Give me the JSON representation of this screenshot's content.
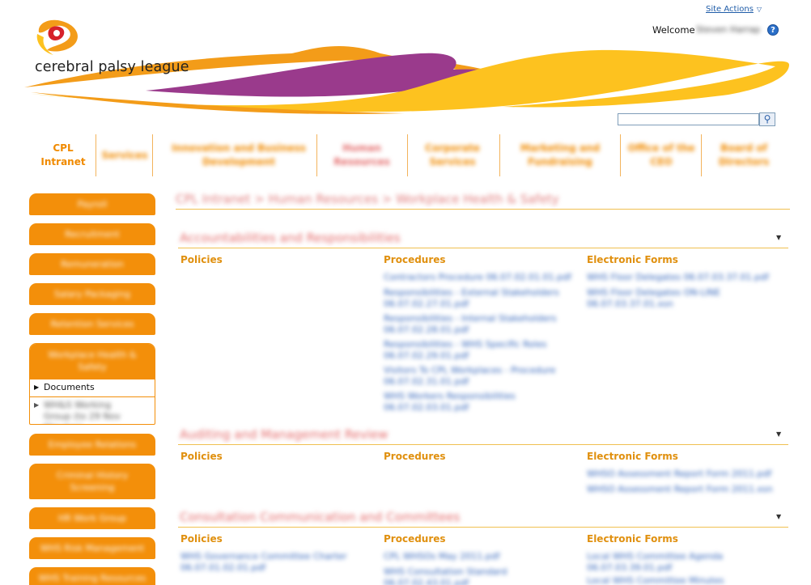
{
  "header": {
    "site_actions": "Site Actions",
    "welcome": "Welcome",
    "user_name": "Steven Harrap",
    "help": "?",
    "logo_text": "cerebral palsy league",
    "search": {
      "placeholder": "",
      "value": ""
    }
  },
  "top_nav": [
    "CPL Intranet",
    "Services",
    "Innovation and Business Development",
    "Human Resources",
    "Corporate Services",
    "Marketing and Fundraising",
    "Office of the CEO",
    "Board of Directors"
  ],
  "left_nav": {
    "items_before": [
      "Payroll",
      "Recruitment",
      "Remuneration",
      "Salary Packaging",
      "Retention Services"
    ],
    "expanded": {
      "label": "Workplace Health & Safety",
      "children": [
        "Documents",
        "WH&S Working Group (to 29 Nov Minutes)"
      ]
    },
    "items_after": [
      "Employee Relations",
      "Criminal History Screening",
      "HR Work Group",
      "WHS Risk Management",
      "WHS Training Resources"
    ]
  },
  "breadcrumb": "CPL Intranet > Human Resources > Workplace Health & Safety",
  "sections": [
    {
      "title": "Accountabilities and Responsibilities",
      "columns": [
        {
          "header": "Policies",
          "links": []
        },
        {
          "header": "Procedures",
          "links": [
            "Contractors Procedure 06.07.02.01.01.pdf",
            "Responsibilities - External Stakeholders 06.07.02.27.01.pdf",
            "Responsibilities - Internal Stakeholders 06.07.02.28.01.pdf",
            "Responsibilities - WHS Specific Roles 06.07.02.29.01.pdf",
            "Visitors To CPL Workplaces - Procedure 06.07.02.31.01.pdf",
            "WHS Workers Responsibilities 06.07.02.03.01.pdf"
          ]
        },
        {
          "header": "Electronic Forms",
          "links": [
            "WHS Floor Delegates 06.07.03.37.01.pdf",
            "WHS Floor Delegates ON-LINE 06.07.03.37.01.xsn"
          ]
        }
      ]
    },
    {
      "title": "Auditing and Management Review",
      "columns": [
        {
          "header": "Policies",
          "links": []
        },
        {
          "header": "Procedures",
          "links": []
        },
        {
          "header": "Electronic Forms",
          "links": [
            "WHSO Assessment Report Form 2011.pdf",
            "WHSO Assessment Report Form 2011.xsn"
          ]
        }
      ]
    },
    {
      "title": "Consultation Communication and Committees",
      "columns": [
        {
          "header": "Policies",
          "links": [
            "WHS Governance Committee Charter 06.07.01.02.01.pdf"
          ]
        },
        {
          "header": "Procedures",
          "links": [
            "CPL WHSOs May 2011.pdf",
            "WHS Consultation Standard 06.07.02.43.01.pdf"
          ]
        },
        {
          "header": "Electronic Forms",
          "links": [
            "Local WHS Committee Agenda 06.07.03.39.01.pdf",
            "Local WHS Committee Minutes"
          ]
        }
      ]
    }
  ],
  "colors": {
    "orange": "#f38f0a",
    "gold": "#fdc21f",
    "purple": "#9a3a8c",
    "link": "#2b5fb8"
  }
}
